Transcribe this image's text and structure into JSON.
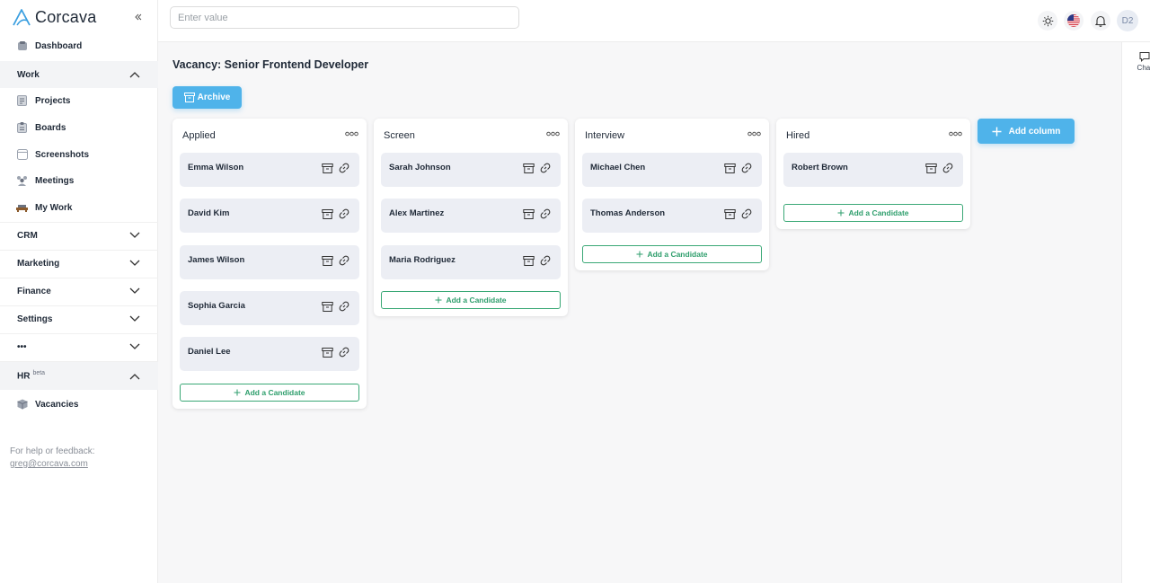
{
  "app": {
    "name": "Corcava"
  },
  "search": {
    "placeholder": "Enter value"
  },
  "sidebar": {
    "dashboard": "Dashboard",
    "work": {
      "label": "Work",
      "items": [
        {
          "label": "Projects",
          "icon": "projects-icon"
        },
        {
          "label": "Boards",
          "icon": "boards-icon"
        },
        {
          "label": "Screenshots",
          "icon": "screenshots-icon"
        },
        {
          "label": "Meetings",
          "icon": "meetings-icon"
        },
        {
          "label": "My Work",
          "icon": "my-work-icon"
        }
      ]
    },
    "sections": [
      "CRM",
      "Marketing",
      "Finance",
      "Settings",
      "•••"
    ],
    "hr": {
      "label": "HR",
      "badge": "beta",
      "items": [
        {
          "label": "Vacancies",
          "icon": "vacancies-icon"
        }
      ]
    },
    "help": {
      "text": "For help or feedback:",
      "email": "greg@corcava.com"
    }
  },
  "topbar": {
    "avatar": "D2",
    "flag": "US"
  },
  "chat": {
    "label": "Chat"
  },
  "page": {
    "title": "Vacancy: Senior Frontend Developer",
    "archive_label": "Archive",
    "add_column_label": "Add column",
    "add_candidate_label": "Add a Candidate"
  },
  "columns": [
    {
      "title": "Applied",
      "candidates": [
        "Emma Wilson",
        "David Kim",
        "James Wilson",
        "Sophia Garcia",
        "Daniel Lee"
      ]
    },
    {
      "title": "Screen",
      "candidates": [
        "Sarah Johnson",
        "Alex Martinez",
        "Maria Rodriguez"
      ]
    },
    {
      "title": "Interview",
      "candidates": [
        "Michael Chen",
        "Thomas Anderson"
      ]
    },
    {
      "title": "Hired",
      "candidates": [
        "Robert Brown"
      ]
    }
  ],
  "colors": {
    "accent": "#4fb3ea",
    "success": "#2e9e6c",
    "card_bg": "#eceef4"
  }
}
